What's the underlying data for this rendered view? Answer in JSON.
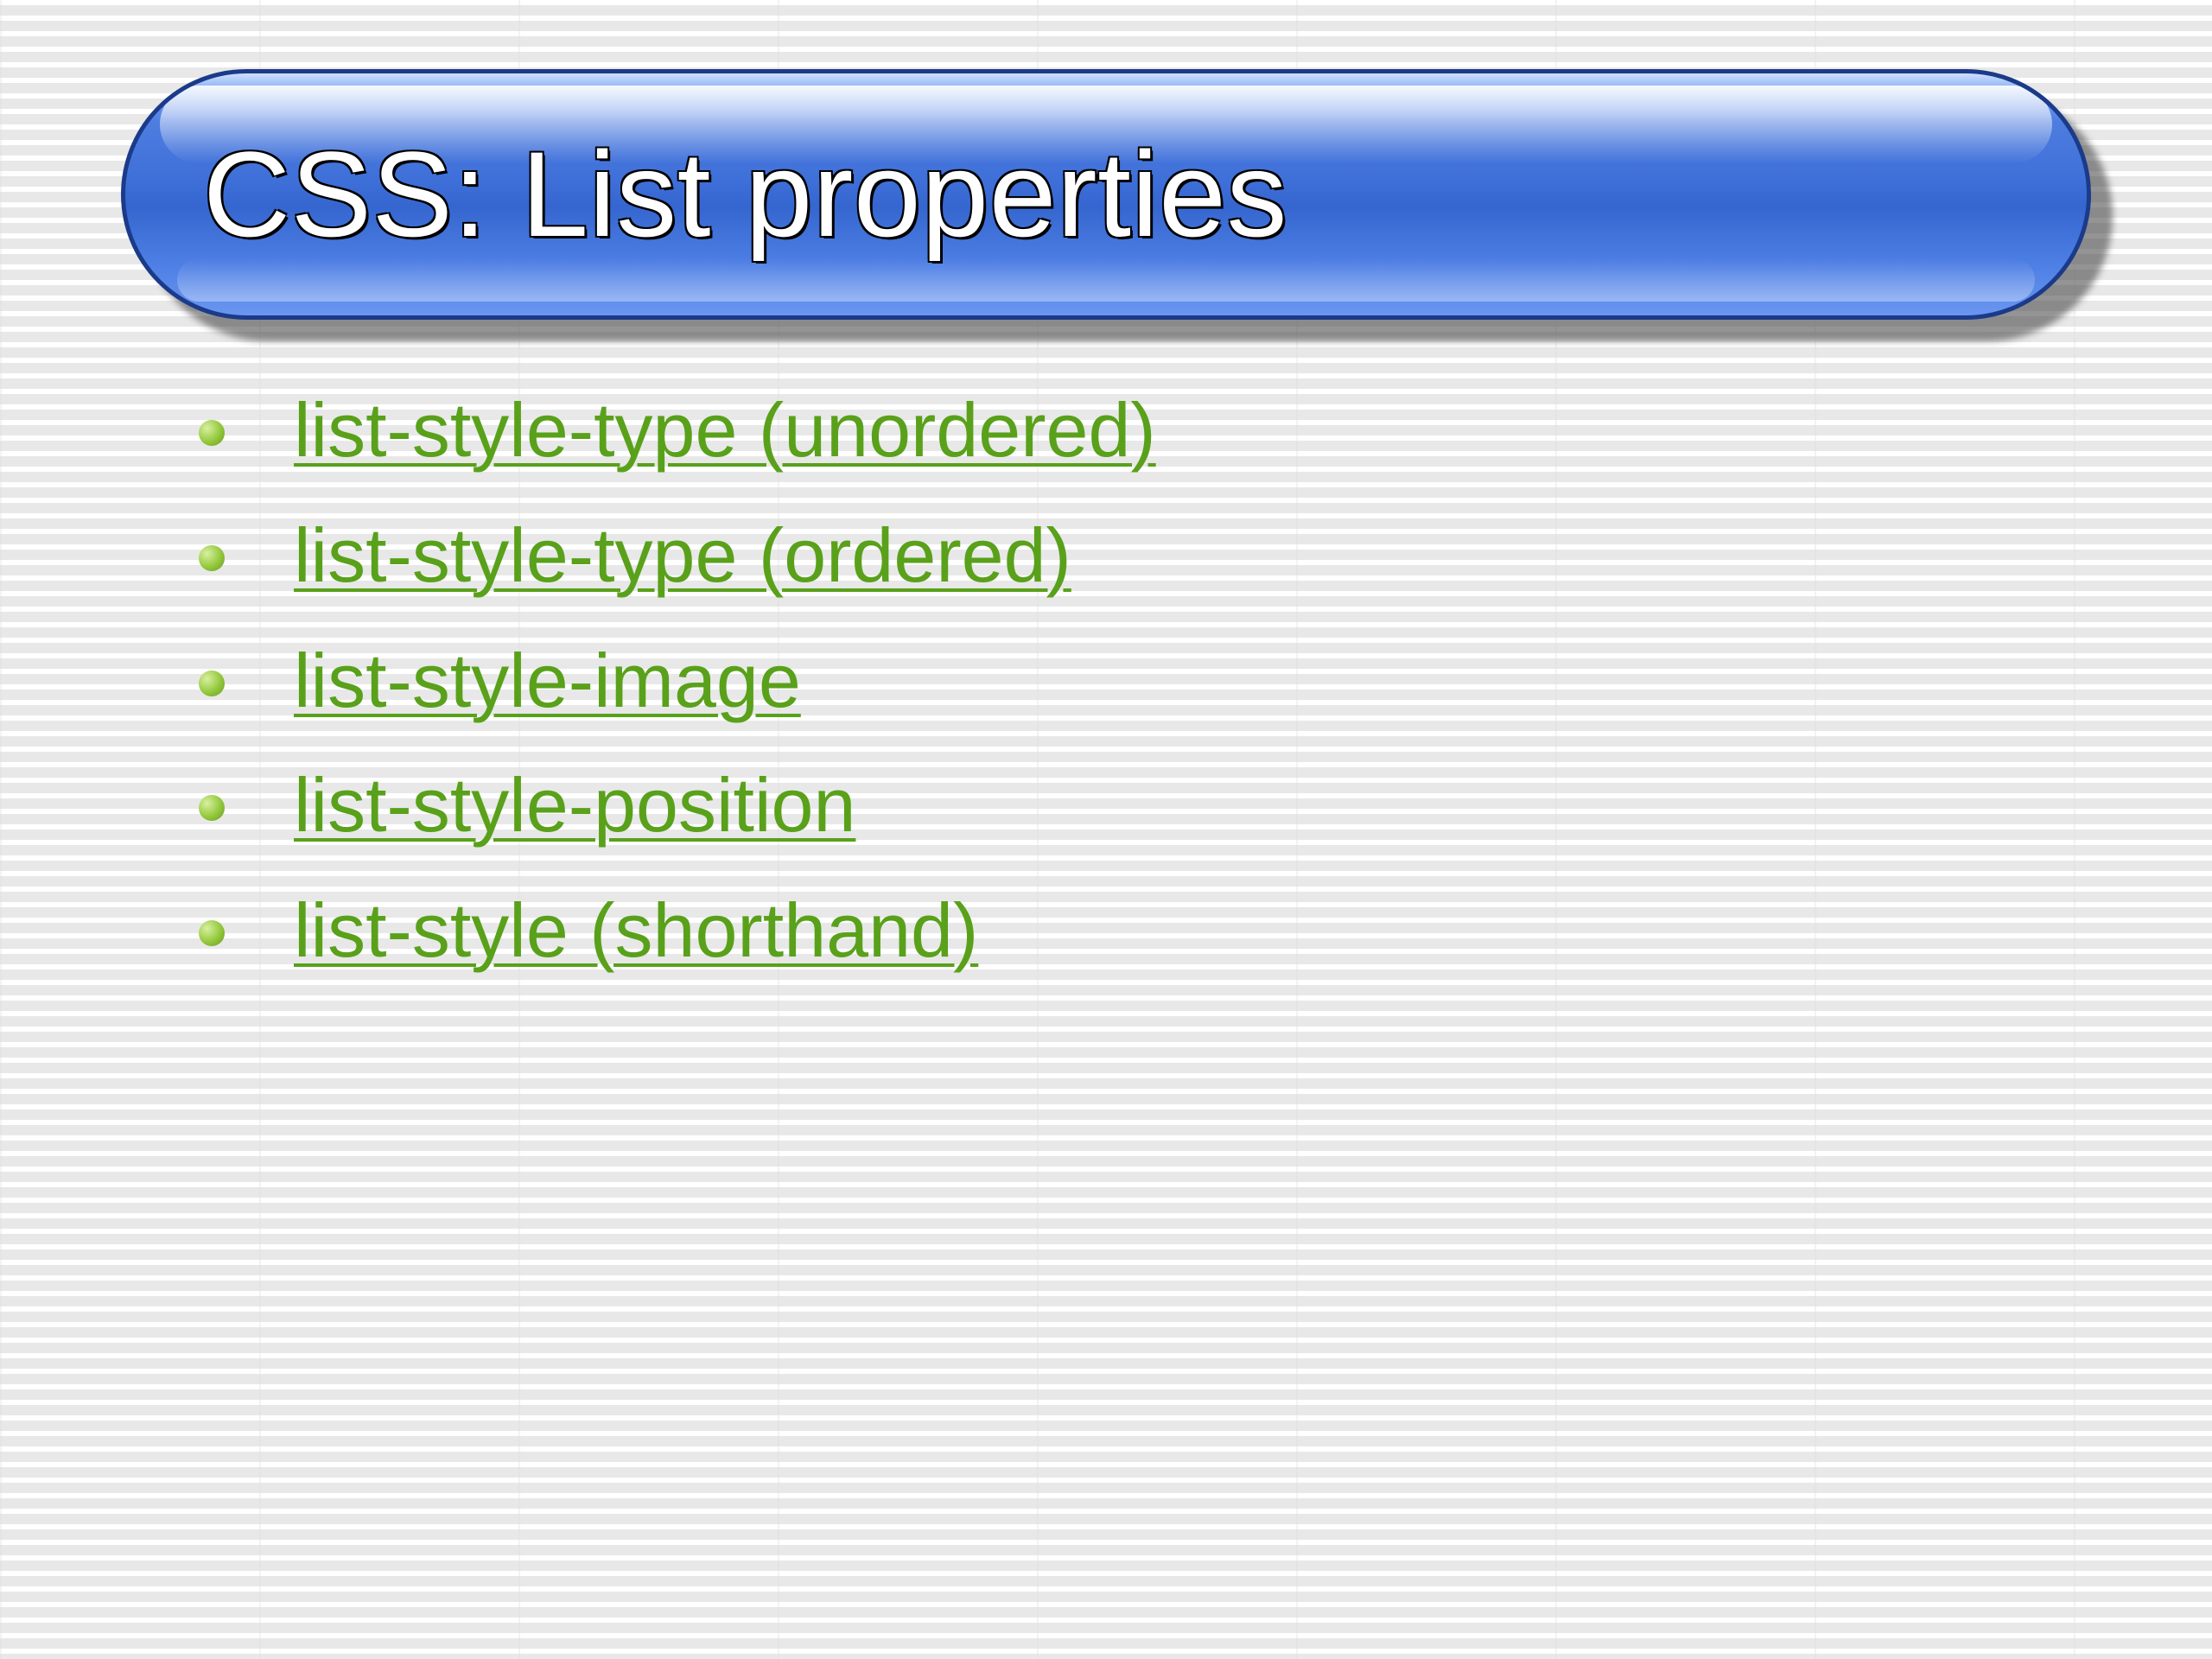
{
  "title": "CSS: List properties",
  "items": [
    {
      "label": "list-style-type (unordered)"
    },
    {
      "label": "list-style-type (ordered)"
    },
    {
      "label": "list-style-image"
    },
    {
      "label": "list-style-position"
    },
    {
      "label": "list-style (shorthand)"
    }
  ],
  "colors": {
    "link": "#59a11a",
    "pill_primary": "#4e7de0",
    "bullet": "#93c83c"
  }
}
